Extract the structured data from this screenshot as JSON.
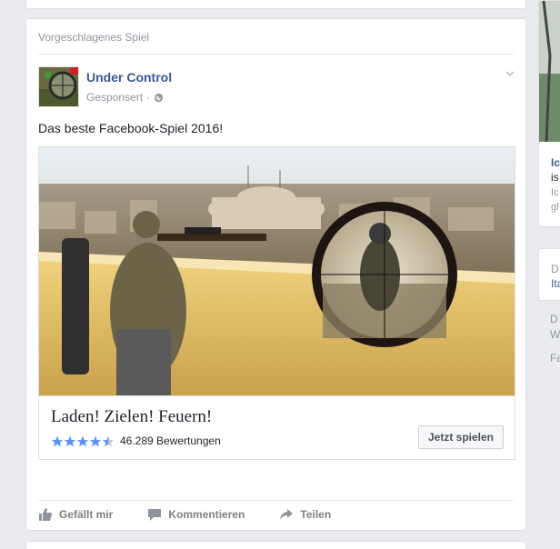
{
  "post": {
    "label": "Vorgeschlagenes Spiel",
    "page_name": "Under Control",
    "sponsored": "Gesponsert",
    "sponsored_sep": "·",
    "text": "Das beste Facebook-Spiel 2016!",
    "ad": {
      "title": "Laden! Zielen! Feuern!",
      "rating_value": 4.5,
      "rating_text": "46.289 Bewertungen",
      "cta": "Jetzt spielen"
    },
    "actions": {
      "like": "Gefällt mir",
      "comment": "Kommentieren",
      "share": "Teilen"
    }
  },
  "right_column": {
    "card1": {
      "line1": "Ic",
      "line2": "is",
      "line3": "Ic",
      "line4": "gl"
    },
    "card2": {
      "line1": "D",
      "line2": "Ita"
    },
    "footer": {
      "line1": "D",
      "line2": "W",
      "line3": "Fa"
    }
  },
  "colors": {
    "link": "#365899",
    "meta": "#90949c",
    "background": "#e9ebee",
    "star": "#5890ff"
  }
}
